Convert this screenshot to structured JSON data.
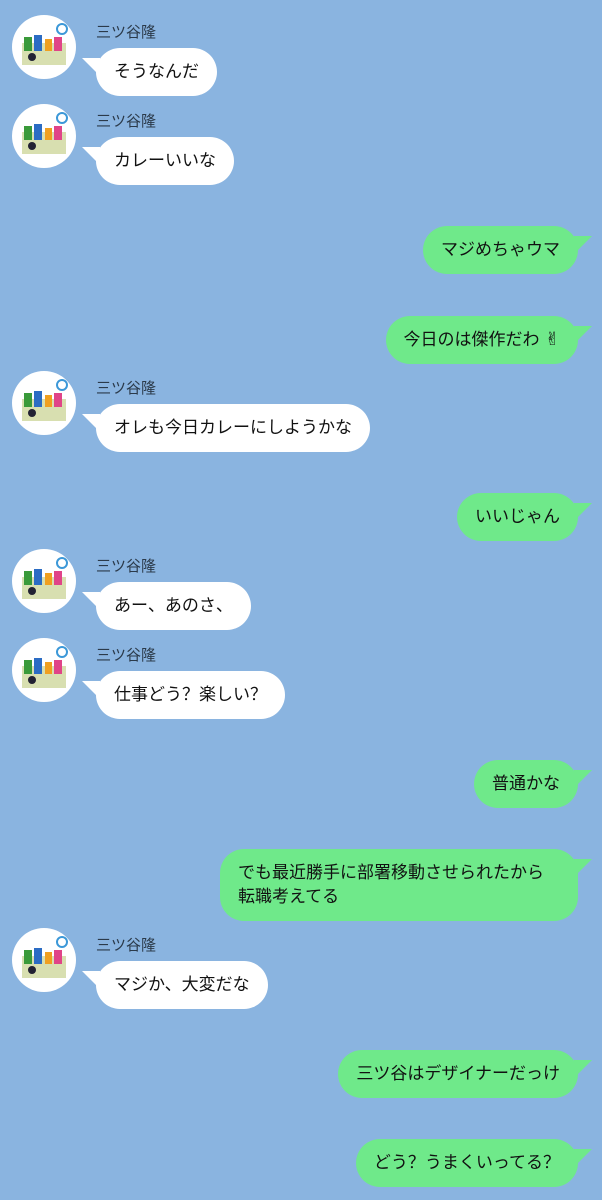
{
  "contact": {
    "name": "三ツ谷隆",
    "avatar_icon": "sewing-kit-icon"
  },
  "colors": {
    "background": "#8AB4E0",
    "incoming": "#ffffff",
    "outgoing": "#6FE98A"
  },
  "messages": [
    {
      "side": "in",
      "text": "そうなんだ"
    },
    {
      "side": "in",
      "text": "カレーいいな"
    },
    {
      "side": "out",
      "text": "マジめちゃウマ"
    },
    {
      "side": "out",
      "text": "今日のは傑作だわ",
      "emoji": "✌"
    },
    {
      "side": "in",
      "text": "オレも今日カレーにしようかな"
    },
    {
      "side": "out",
      "text": "いいじゃん"
    },
    {
      "side": "in",
      "text": "あー、あのさ、"
    },
    {
      "side": "in",
      "text": "仕事どう？楽しい？"
    },
    {
      "side": "out",
      "text": "普通かな"
    },
    {
      "side": "out",
      "text": "でも最近勝手に部署移動させられたから転職考えてる"
    },
    {
      "side": "in",
      "text": "マジか、大変だな"
    },
    {
      "side": "out",
      "text": "三ツ谷はデザイナーだっけ"
    },
    {
      "side": "out",
      "text": "どう？うまくいってる？"
    }
  ]
}
